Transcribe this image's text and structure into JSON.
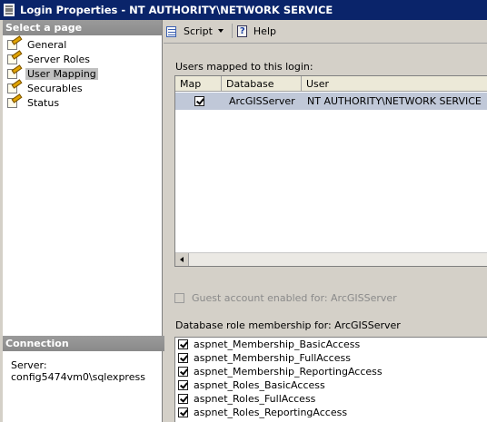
{
  "window": {
    "title": "Login Properties - NT AUTHORITY\\NETWORK SERVICE"
  },
  "left_pane": {
    "header": "Select a page",
    "pages": [
      {
        "label": "General",
        "selected": false
      },
      {
        "label": "Server Roles",
        "selected": false
      },
      {
        "label": "User Mapping",
        "selected": true
      },
      {
        "label": "Securables",
        "selected": false
      },
      {
        "label": "Status",
        "selected": false
      }
    ]
  },
  "connection": {
    "header": "Connection",
    "server_label": "Server:",
    "server_value": "config5474vm0\\sqlexpress"
  },
  "toolbar": {
    "script_label": "Script",
    "help_label": "Help"
  },
  "users_mapped": {
    "label": "Users mapped to this login:",
    "columns": [
      "Map",
      "Database",
      "User"
    ],
    "rows": [
      {
        "map": true,
        "database": "ArcGISServer",
        "user": "NT AUTHORITY\\NETWORK SERVICE"
      }
    ]
  },
  "guest": {
    "label": "Guest account enabled for: ArcGISServer",
    "checked": false,
    "enabled": false
  },
  "roles": {
    "label": "Database role membership for: ArcGISServer",
    "items": [
      {
        "label": "aspnet_Membership_BasicAccess",
        "checked": true
      },
      {
        "label": "aspnet_Membership_FullAccess",
        "checked": true
      },
      {
        "label": "aspnet_Membership_ReportingAccess",
        "checked": true
      },
      {
        "label": "aspnet_Roles_BasicAccess",
        "checked": true
      },
      {
        "label": "aspnet_Roles_FullAccess",
        "checked": true
      },
      {
        "label": "aspnet_Roles_ReportingAccess",
        "checked": true
      }
    ]
  }
}
